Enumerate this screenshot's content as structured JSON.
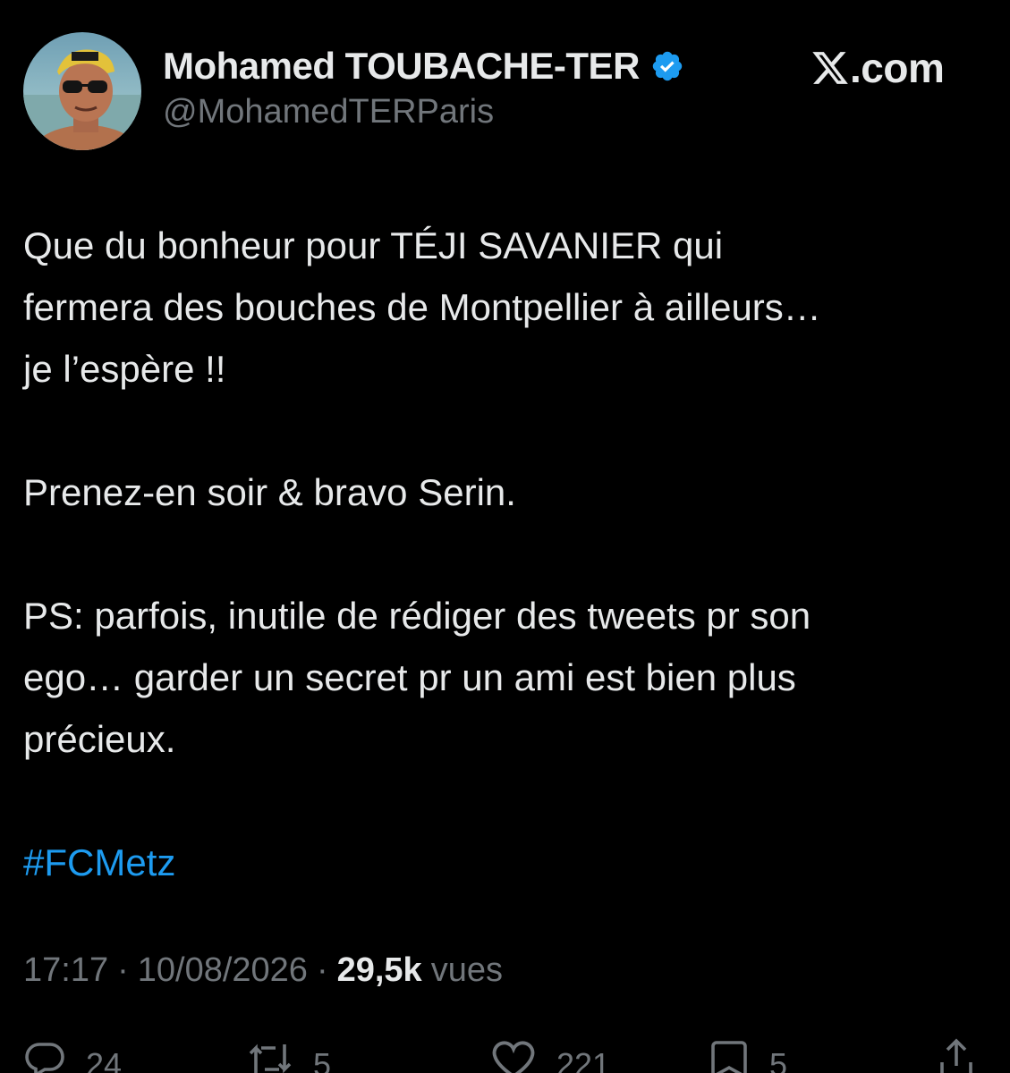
{
  "author": {
    "display_name": "Mohamed TOUBACHE-TER",
    "handle": "@MohamedTERParis",
    "verified_icon": "verified-badge-icon",
    "verified_color": "#1d9bf0"
  },
  "brand": {
    "icon": "x-logo-icon",
    "text": ".com"
  },
  "tweet": {
    "paragraphs": [
      [
        "Que du bonheur pour TÉJI SAVANIER qui",
        "fermera des bouches de Montpellier à ailleurs…",
        "je l’espère !!"
      ],
      [
        "Prenez-en soir & bravo Serin."
      ],
      [
        "PS: parfois, inutile de rédiger des tweets pr son",
        "ego… garder un secret pr un ami est bien plus",
        "précieux."
      ]
    ],
    "hashtag": "#FCMetz",
    "hashtag_color": "#1d9bf0"
  },
  "meta": {
    "time": "17:17",
    "separator": "·",
    "date": "10/08/2026",
    "views_count": "29,5k",
    "views_label": "vues"
  },
  "actions": {
    "replies": "24",
    "reposts": "5",
    "likes": "221",
    "bookmarks": "5"
  }
}
